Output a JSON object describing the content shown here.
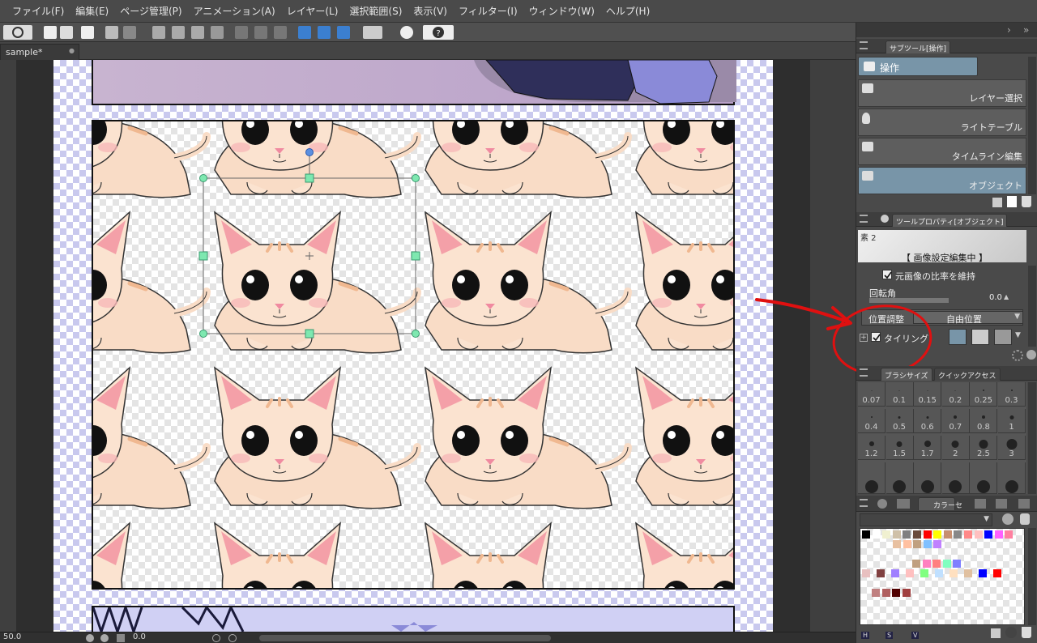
{
  "menu": [
    "ファイル(F)",
    "編集(E)",
    "ページ管理(P)",
    "アニメーション(A)",
    "レイヤー(L)",
    "選択範囲(S)",
    "表示(V)",
    "フィルター(I)",
    "ウィンドウ(W)",
    "ヘルプ(H)"
  ],
  "document_tab": {
    "label": "sample*",
    "close": "●"
  },
  "subtool_panel": {
    "title": "サブツール[操作]",
    "group": "操作",
    "items": [
      {
        "label": "レイヤー選択",
        "selected": false,
        "icon": "layer-select-icon"
      },
      {
        "label": "ライトテーブル",
        "selected": false,
        "icon": "light-table-icon"
      },
      {
        "label": "タイムライン編集",
        "selected": false,
        "icon": "timeline-icon"
      },
      {
        "label": "オブジェクト",
        "selected": true,
        "icon": "object-icon"
      }
    ]
  },
  "tool_property": {
    "title": "ツールプロパティ[オブジェクト]",
    "preview_label": "素 2",
    "editing_banner": "【 画像設定編集中 】",
    "keep_ratio_label": "元画像の比率を維持",
    "keep_ratio_checked": true,
    "rotation_label": "回転角",
    "rotation_value": "0.0",
    "position_label": "位置調整",
    "position_value": "自由位置",
    "tiling_label": "タイリング",
    "tiling_checked": true
  },
  "brush_panel": {
    "tab_brush": "ブラシサイズ",
    "tab_quick": "クイックアクセス",
    "sizes_row1": [
      "0.07",
      "0.1",
      "0.15",
      "0.2",
      "0.25",
      "0.3"
    ],
    "sizes_row2": [
      "0.4",
      "0.5",
      "0.6",
      "0.7",
      "0.8",
      "1"
    ],
    "sizes_row3": [
      "1.2",
      "1.5",
      "1.7",
      "2",
      "2.5",
      "3"
    ]
  },
  "color_panel": {
    "tab_label": "カラーセ",
    "footer": [
      "H",
      "S",
      "V"
    ],
    "swatches_row1": [
      "#000000",
      "#ffffff",
      "#f0f0d0",
      "#cfc0a8",
      "#808080",
      "#6a4a3a",
      "#ff0000",
      "#ffff00",
      "#c89070",
      "#888888",
      "#ff8888",
      "#ffc0c0",
      "#0000ff",
      "#ff60ff",
      "#ff80a0"
    ],
    "swatches_row2": [
      "#e8c0a0",
      "#ffc0a0",
      "#c0a080",
      "#80c0ff",
      "#c080ff"
    ],
    "swatches_row3": [
      "#c0a080",
      "#ff80c0",
      "#ff8080",
      "#80ffc0",
      "#8080ff"
    ],
    "swatches_row4": [
      "#e8c0c0",
      "#804040",
      "#a080ff",
      "#ffc0c0",
      "#80ff80",
      "#c0e0ff",
      "#ffe0c0",
      "#e0c0a0",
      "#0000ff",
      "#ff0000"
    ],
    "swatches_row5": [
      "#c08080",
      "#b06060",
      "#500000",
      "#a04040"
    ]
  },
  "status": {
    "zoom": "50.0",
    "rotation": "0.0"
  },
  "colors": {
    "accent_selected": "#7895a8",
    "panel_bg": "#4a4a4a",
    "page_checker": "#c9c9ee",
    "annotation_red": "#e01010"
  }
}
